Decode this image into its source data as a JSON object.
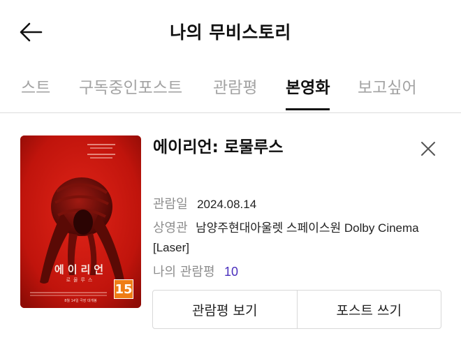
{
  "header": {
    "title": "나의 무비스토리",
    "back_icon": "arrow-left-icon"
  },
  "tabs": [
    {
      "label": "스트",
      "active": false
    },
    {
      "label": "구독중인포스트",
      "active": false
    },
    {
      "label": "관람평",
      "active": false
    },
    {
      "label": "본영화",
      "active": true
    },
    {
      "label": "보고싶어",
      "active": false
    }
  ],
  "movie": {
    "title": "에이리언: 로물루스",
    "poster": {
      "title": "에이리언",
      "subtitle": "로물루스",
      "release_note": "8월 14일 극장 대개봉",
      "rating": "15"
    },
    "watched": {
      "label": "관람일",
      "value": "2024.08.14"
    },
    "theater": {
      "label": "상영관",
      "value": "남양주현대아울렛 스페이스원 Dolby Cinema [Laser]"
    },
    "score": {
      "label": "나의 관람평",
      "value": "10"
    },
    "close_icon": "close-icon"
  },
  "actions": {
    "review_label": "관람평 보기",
    "post_label": "포스트 쓰기"
  },
  "colors": {
    "accent_purple": "#4a2fbd",
    "poster_red": "#c9170f",
    "rating_orange": "#ef7d16",
    "inactive_tab": "#a3a3a3"
  }
}
